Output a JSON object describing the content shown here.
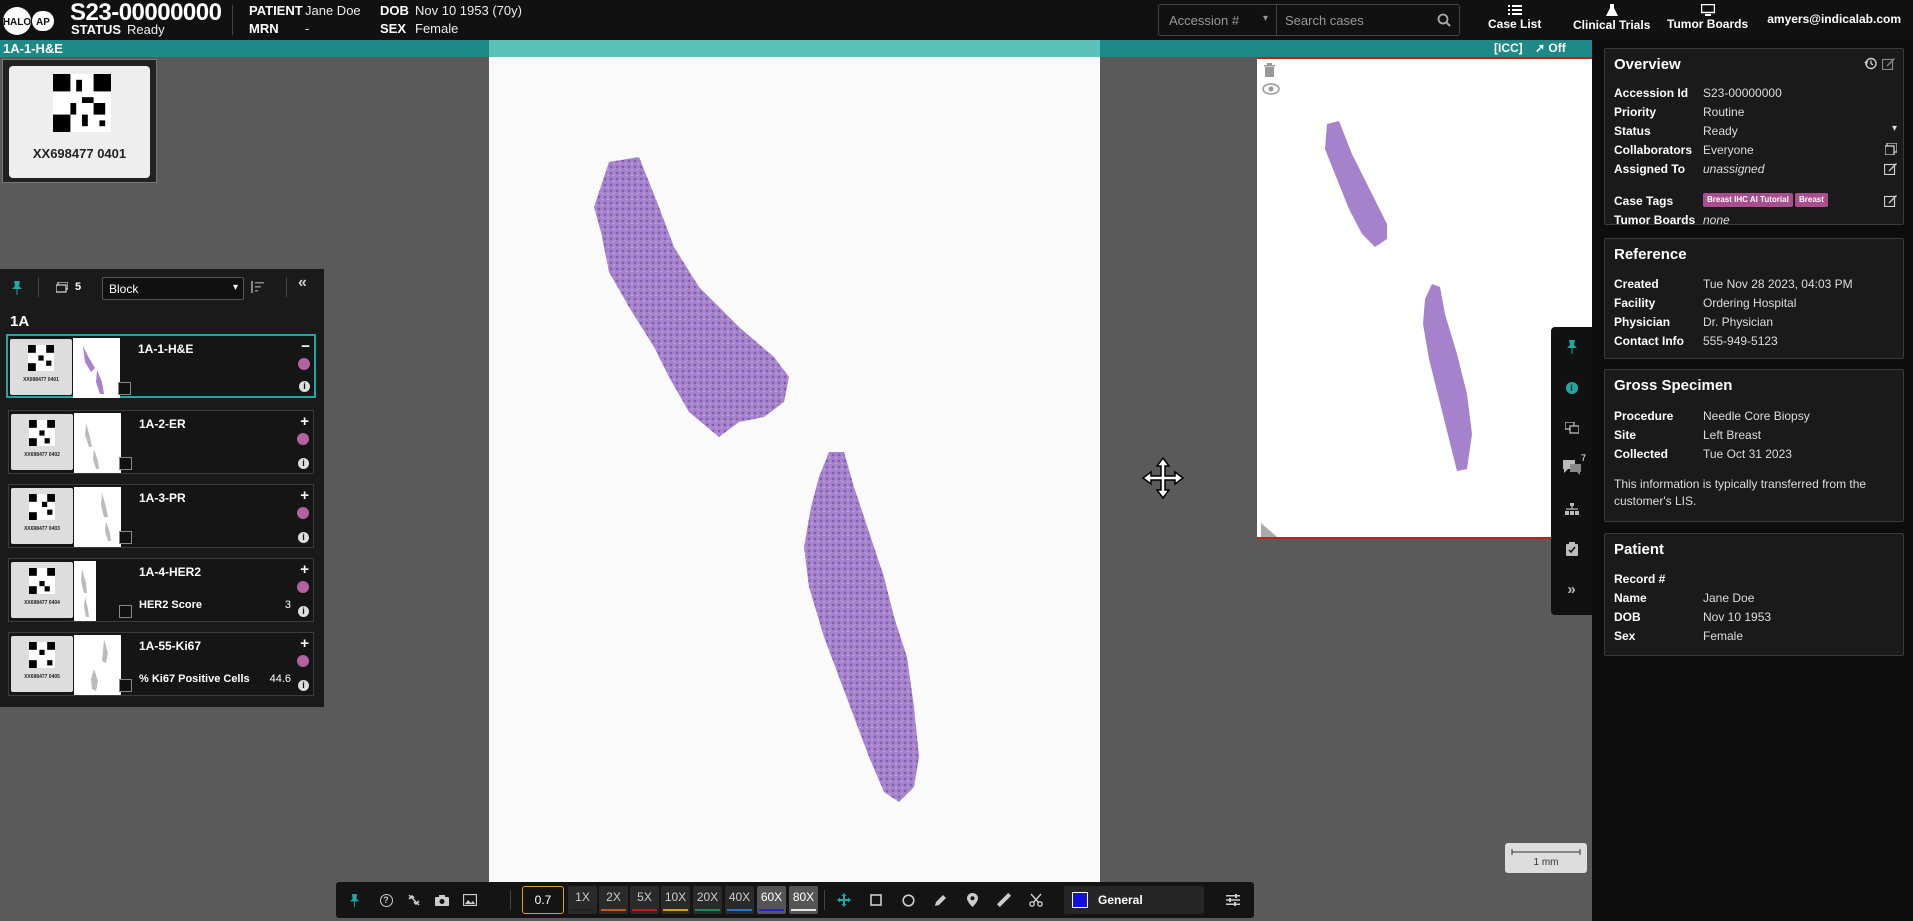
{
  "header": {
    "logo_halo": "HALO",
    "logo_ap": "AP",
    "case_id": "S23-00000000",
    "status_label": "STATUS",
    "status_value": "Ready",
    "patient_label": "PATIENT",
    "patient_value": "Jane Doe",
    "mrn_label": "MRN",
    "mrn_value": "-",
    "dob_label": "DOB",
    "dob_value": "Nov 10 1953 (70y)",
    "sex_label": "SEX",
    "sex_value": "Female",
    "search_select": "Accession #",
    "search_placeholder": "Search cases",
    "nav_case_list": "Case List",
    "nav_clinical_trials": "Clinical Trials",
    "nav_tumor_boards": "Tumor Boards",
    "user_email": "amyers@indicalab.com"
  },
  "viewer": {
    "slide_name": "1A-1-H&E",
    "icc": "[ICC]",
    "live_off": "Off",
    "label_code": "XX698477 0401",
    "scale_text": "1 mm"
  },
  "left_panel": {
    "slide_count": "5",
    "group_by": "Block",
    "block_heading": "1A",
    "slides": [
      {
        "name": "1A-1-H&E",
        "label_code": "XX698477 0401",
        "metric": "",
        "metric_value": "",
        "selected": true
      },
      {
        "name": "1A-2-ER",
        "label_code": "XX698477 0402",
        "metric": "",
        "metric_value": "",
        "selected": false
      },
      {
        "name": "1A-3-PR",
        "label_code": "XX698477 0403",
        "metric": "",
        "metric_value": "",
        "selected": false
      },
      {
        "name": "1A-4-HER2",
        "label_code": "XX698477 0404",
        "metric": "HER2 Score",
        "metric_value": "3",
        "selected": false
      },
      {
        "name": "1A-55-Ki67",
        "label_code": "XX698477 0405",
        "metric": "% Ki67 Positive Cells",
        "metric_value": "44.6",
        "selected": false
      }
    ]
  },
  "overview": {
    "title": "Overview",
    "accession_label": "Accession Id",
    "accession_value": "S23-00000000",
    "priority_label": "Priority",
    "priority_value": "Routine",
    "status_label": "Status",
    "status_value": "Ready",
    "collaborators_label": "Collaborators",
    "collaborators_value": "Everyone",
    "assigned_label": "Assigned To",
    "assigned_value": "unassigned",
    "tags_label": "Case Tags",
    "tag1": "Breast IHC AI Tutorial",
    "tag2": "Breast",
    "tumor_boards_label": "Tumor Boards",
    "tumor_boards_value": "none"
  },
  "reference": {
    "title": "Reference",
    "created_label": "Created",
    "created_value": "Tue Nov 28 2023, 04:03 PM",
    "facility_label": "Facility",
    "facility_value": "Ordering Hospital",
    "physician_label": "Physician",
    "physician_value": "Dr. Physician",
    "contact_label": "Contact Info",
    "contact_value": "555-949-5123"
  },
  "gross": {
    "title": "Gross Specimen",
    "procedure_label": "Procedure",
    "procedure_value": "Needle Core Biopsy",
    "site_label": "Site",
    "site_value": "Left Breast",
    "collected_label": "Collected",
    "collected_value": "Tue Oct 31 2023",
    "note": "This information is typically transferred from the customer's LIS."
  },
  "patient": {
    "title": "Patient",
    "record_label": "Record #",
    "record_value": "",
    "name_label": "Name",
    "name_value": "Jane Doe",
    "dob_label": "DOB",
    "dob_value": "Nov 10 1953",
    "sex_label": "Sex",
    "sex_value": "Female"
  },
  "side_toolbar": {
    "comments_count": "7"
  },
  "bottom_toolbar": {
    "zoom_value": "0.7",
    "zoom_levels": [
      {
        "label": "1X",
        "color": "#222222"
      },
      {
        "label": "2X",
        "color": "#c05a1c"
      },
      {
        "label": "5X",
        "color": "#b81c1c"
      },
      {
        "label": "10X",
        "color": "#d4a017"
      },
      {
        "label": "20X",
        "color": "#1c8a5a"
      },
      {
        "label": "40X",
        "color": "#2a72c8"
      },
      {
        "label": "60X",
        "color": "#2424d0"
      },
      {
        "label": "80X",
        "color": "#e8e8e8"
      }
    ],
    "annotation_class": "General",
    "annotation_color": "#1010e0"
  }
}
